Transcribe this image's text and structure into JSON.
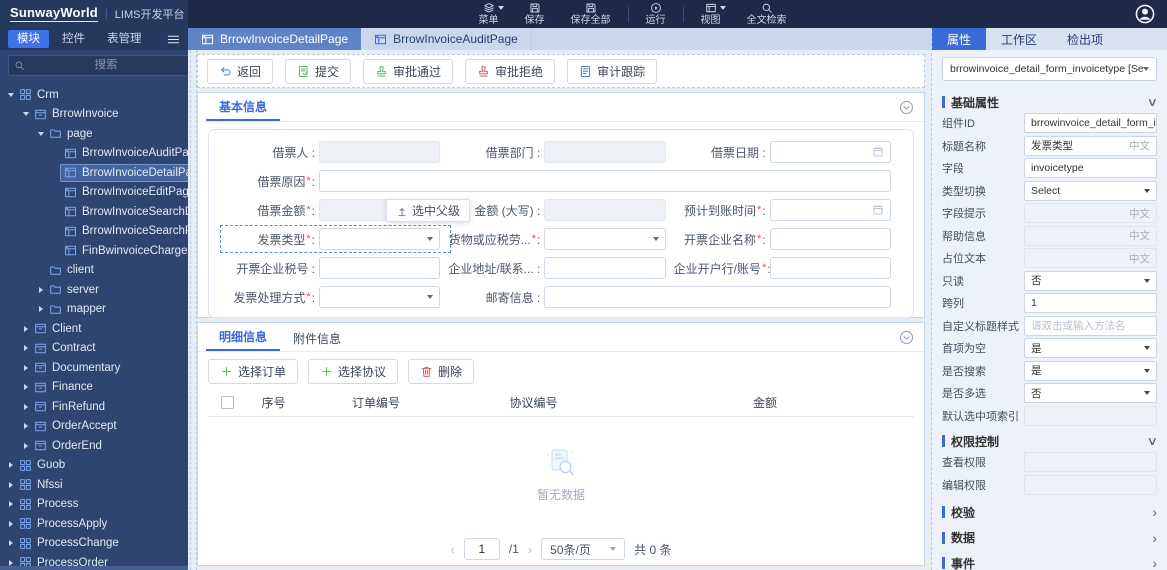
{
  "colors": {
    "primary": "#3a6bd9",
    "topbar_bg": "#1c2a47",
    "sidebar_bg": "#2f4571",
    "active_tab_blue": "#3e73e8",
    "center_tab_active": "#5e84c6",
    "green": "#53b96a",
    "red": "#e05b5b",
    "link_blue": "#4a7fd4"
  },
  "topbar": {
    "brand": "SunwayWorld",
    "brand_divider": "|",
    "product": "LIMS开发平台",
    "menu_items": [
      {
        "label": "菜单",
        "icon": "layers-icon",
        "caret": true
      },
      {
        "label": "保存",
        "icon": "save-icon"
      },
      {
        "label": "保存全部",
        "icon": "save-all-icon"
      },
      {
        "label": "运行",
        "icon": "run-icon",
        "divider_before": true
      },
      {
        "label": "视图",
        "icon": "view-icon",
        "caret": true,
        "divider_before": true
      },
      {
        "label": "全文检索",
        "icon": "search-icon"
      }
    ]
  },
  "sidebar": {
    "tabs": [
      {
        "label": "模块",
        "active": true
      },
      {
        "label": "控件",
        "active": false
      },
      {
        "label": "表管理",
        "active": false
      }
    ],
    "search_placeholder": "搜索",
    "tree": [
      {
        "label": "Crm",
        "level": 0,
        "caret": "down",
        "icon": "grid-icon"
      },
      {
        "label": "BrrowInvoice",
        "level": 1,
        "caret": "down",
        "icon": "module-icon"
      },
      {
        "label": "page",
        "level": 2,
        "caret": "down",
        "icon": "folder-icon"
      },
      {
        "label": "BrrowInvoiceAuditPage",
        "level": 3,
        "caret": "none",
        "icon": "page-icon"
      },
      {
        "label": "BrrowInvoiceDetailPage",
        "level": 3,
        "caret": "none",
        "icon": "page-icon",
        "selected": true
      },
      {
        "label": "BrrowInvoiceEditPage",
        "level": 3,
        "caret": "none",
        "icon": "page-icon"
      },
      {
        "label": "BrrowInvoiceSearchDealPage",
        "level": 3,
        "caret": "none",
        "icon": "page-icon"
      },
      {
        "label": "BrrowInvoiceSearchPage",
        "level": 3,
        "caret": "none",
        "icon": "page-icon"
      },
      {
        "label": "FinBwinvoiceChargeDetailPage",
        "level": 3,
        "caret": "none",
        "icon": "page-icon"
      },
      {
        "label": "client",
        "level": 2,
        "caret": "none",
        "icon": "folder-icon"
      },
      {
        "label": "server",
        "level": 2,
        "caret": "right",
        "icon": "folder-icon"
      },
      {
        "label": "mapper",
        "level": 2,
        "caret": "right",
        "icon": "folder-icon"
      },
      {
        "label": "Client",
        "level": 1,
        "caret": "right",
        "icon": "module-icon"
      },
      {
        "label": "Contract",
        "level": 1,
        "caret": "right",
        "icon": "module-icon"
      },
      {
        "label": "Documentary",
        "level": 1,
        "caret": "right",
        "icon": "module-icon"
      },
      {
        "label": "Finance",
        "level": 1,
        "caret": "right",
        "icon": "module-icon"
      },
      {
        "label": "FinRefund",
        "level": 1,
        "caret": "right",
        "icon": "module-icon"
      },
      {
        "label": "OrderAccept",
        "level": 1,
        "caret": "right",
        "icon": "module-icon"
      },
      {
        "label": "OrderEnd",
        "level": 1,
        "caret": "right",
        "icon": "module-icon"
      },
      {
        "label": "Guob",
        "level": 0,
        "caret": "right",
        "icon": "grid-icon"
      },
      {
        "label": "Nfssi",
        "level": 0,
        "caret": "right",
        "icon": "grid-icon"
      },
      {
        "label": "Process",
        "level": 0,
        "caret": "right",
        "icon": "grid-icon"
      },
      {
        "label": "ProcessApply",
        "level": 0,
        "caret": "right",
        "icon": "grid-icon"
      },
      {
        "label": "ProcessChange",
        "level": 0,
        "caret": "right",
        "icon": "grid-icon"
      },
      {
        "label": "ProcessOrder",
        "level": 0,
        "caret": "right",
        "icon": "grid-icon"
      }
    ]
  },
  "workspace": {
    "tabs": [
      {
        "label": "BrrowInvoiceDetailPage",
        "active": true
      },
      {
        "label": "BrrowInvoiceAuditPage",
        "active": false
      }
    ],
    "action_buttons": [
      {
        "label": "返回",
        "icon": "back-icon",
        "color": "#4a7fd4"
      },
      {
        "label": "提交",
        "icon": "submit-doc-icon",
        "color": "#53b96a"
      },
      {
        "label": "审批通过",
        "icon": "stamp-approve-icon",
        "color": "#53b96a"
      },
      {
        "label": "审批拒绝",
        "icon": "stamp-reject-icon",
        "color": "#e05b5b"
      },
      {
        "label": "审计跟踪",
        "icon": "audit-doc-icon",
        "color": "#4a7fd4"
      }
    ],
    "basic_panel": {
      "tab": "基本信息",
      "tooltip": "选中父级",
      "rows": [
        {
          "cells": [
            {
              "label": "借票人",
              "required": false,
              "control": "input-disabled",
              "span": 1
            },
            {
              "label": "借票部门",
              "required": false,
              "control": "input-disabled",
              "span": 1
            },
            {
              "label": "借票日期",
              "required": false,
              "control": "date",
              "span": 1
            }
          ]
        },
        {
          "cells": [
            {
              "label": "借票原因",
              "required": true,
              "control": "input",
              "span": 3
            }
          ]
        },
        {
          "cells": [
            {
              "label": "借票金额",
              "required": true,
              "control": "input-disabled",
              "span": 1
            },
            {
              "label": "金额 (大写)",
              "required": false,
              "control": "input-disabled",
              "span": 1
            },
            {
              "label": "预计到账时间",
              "required": true,
              "control": "date",
              "span": 1
            }
          ]
        },
        {
          "cells": [
            {
              "label": "发票类型",
              "required": true,
              "control": "select",
              "span": 1,
              "selected": true
            },
            {
              "label": "货物或应税劳...",
              "required": true,
              "control": "select",
              "span": 1
            },
            {
              "label": "开票企业名称",
              "required": true,
              "control": "input",
              "span": 1
            }
          ]
        },
        {
          "cells": [
            {
              "label": "开票企业税号",
              "required": false,
              "control": "input",
              "span": 1
            },
            {
              "label": "企业地址/联系...",
              "required": false,
              "control": "input",
              "span": 1
            },
            {
              "label": "企业开户行/账号",
              "required": true,
              "control": "input",
              "span": 1
            }
          ]
        },
        {
          "cells": [
            {
              "label": "发票处理方式",
              "required": true,
              "control": "select",
              "span": 1
            },
            {
              "label": "邮寄信息",
              "required": false,
              "control": "input",
              "span": 2
            }
          ]
        }
      ]
    },
    "detail_panel": {
      "tabs": [
        {
          "label": "明细信息",
          "active": true
        },
        {
          "label": "附件信息",
          "active": false
        }
      ],
      "buttons": [
        {
          "label": "选择订单",
          "icon": "plus-icon",
          "color": "#53b96a"
        },
        {
          "label": "选择协议",
          "icon": "plus-icon",
          "color": "#53b96a"
        },
        {
          "label": "删除",
          "icon": "trash-icon",
          "color": "#e05b5b"
        }
      ],
      "columns": [
        "序号",
        "订单编号",
        "协议编号",
        "金额"
      ],
      "empty_text": "暂无数据",
      "pagination": {
        "prev": "‹",
        "page": "1",
        "of": "/1",
        "next": "›",
        "page_size": "50条/页",
        "total": "共 0 条"
      }
    }
  },
  "inspector": {
    "tabs": [
      {
        "label": "属性",
        "active": true
      },
      {
        "label": "工作区",
        "active": false
      },
      {
        "label": "检出项",
        "active": false
      }
    ],
    "component_selector": "brrowinvoice_detail_form_invoicetype [Select]",
    "sections": [
      {
        "title": "基础属性",
        "state": "expanded",
        "rows": [
          {
            "label": "组件ID",
            "type": "input",
            "value": "brrowinvoice_detail_form_invoic"
          },
          {
            "label": "标题名称",
            "type": "input",
            "value": "发票类型",
            "suffix": "中文"
          },
          {
            "label": "字段",
            "type": "input",
            "value": "invoicetype"
          },
          {
            "label": "类型切换",
            "type": "select",
            "value": "Select"
          },
          {
            "label": "字段提示",
            "type": "input-disabled",
            "value": "",
            "suffix": "中文"
          },
          {
            "label": "帮助信息",
            "type": "input-disabled",
            "value": "",
            "suffix": "中文"
          },
          {
            "label": "占位文本",
            "type": "input-disabled",
            "value": "",
            "suffix": "中文"
          },
          {
            "label": "只读",
            "type": "select",
            "value": "否"
          },
          {
            "label": "跨列",
            "type": "input",
            "value": "1"
          },
          {
            "label": "自定义标题样式",
            "type": "input",
            "value": "",
            "placeholder": "请双击或输入方法名"
          },
          {
            "label": "首项为空",
            "type": "select",
            "value": "是"
          },
          {
            "label": "是否搜索",
            "type": "select",
            "value": "是"
          },
          {
            "label": "是否多选",
            "type": "select",
            "value": "否"
          },
          {
            "label": "默认选中项索引",
            "type": "input-disabled",
            "value": ""
          }
        ]
      },
      {
        "title": "权限控制",
        "state": "expanded",
        "rows": [
          {
            "label": "查看权限",
            "type": "input-disabled",
            "value": ""
          },
          {
            "label": "编辑权限",
            "type": "input-disabled",
            "value": ""
          }
        ]
      },
      {
        "title": "校验",
        "state": "collapsed",
        "rows": []
      },
      {
        "title": "数据",
        "state": "collapsed",
        "rows": []
      },
      {
        "title": "事件",
        "state": "collapsed",
        "rows": []
      }
    ]
  }
}
